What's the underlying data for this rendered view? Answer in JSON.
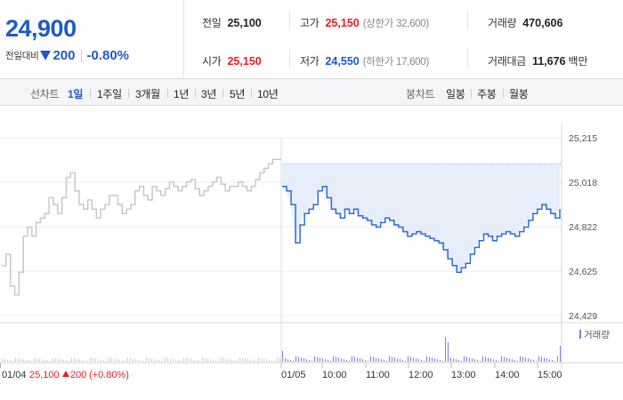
{
  "quote": {
    "current_price": "24,900",
    "change_label": "전일대비",
    "change_value": "200",
    "change_rate": "-0.80%",
    "stats": {
      "prev_close": {
        "label": "전일",
        "value": "25,100"
      },
      "high": {
        "label": "고가",
        "value": "25,150",
        "sub": "(상한가 32,600)"
      },
      "volume": {
        "label": "거래량",
        "value": "470,606"
      },
      "open": {
        "label": "시가",
        "value": "25,150"
      },
      "low": {
        "label": "저가",
        "value": "24,550",
        "sub": "(하한가 17,600)"
      },
      "trade_amount": {
        "label": "거래대금",
        "value": "11,676",
        "unit": "백만"
      }
    }
  },
  "toolbar": {
    "line_chart_label": "선차트",
    "ranges": [
      "1일",
      "1주일",
      "3개월",
      "1년",
      "3년",
      "5년",
      "10년"
    ],
    "active_range": "1일",
    "candle_chart_label": "봉차트",
    "candle_options": [
      "일봉",
      "주봉",
      "월봉"
    ]
  },
  "colors": {
    "price_down": "#1f5ac8",
    "price_up": "#e2202a",
    "today_line": "#2f6fd0",
    "prev_line": "#c8c8c8",
    "fill": "#e6eefa",
    "volume_bar": "#8a7bd0"
  },
  "chart_data": {
    "type": "line",
    "ylim": [
      24429,
      25215
    ],
    "y_ticks": [
      "25,215",
      "25,018",
      "24,822",
      "24,625",
      "24,429"
    ],
    "y_tick_values": [
      25215,
      25018,
      24822,
      24625,
      24429
    ],
    "x_ticks": [
      "01/04",
      "01/05",
      "10:00",
      "11:00",
      "12:00",
      "13:00",
      "14:00",
      "15:00"
    ],
    "prev_close": 25100,
    "legend": "거래량",
    "footer": {
      "date": "01/04",
      "price": "25,100",
      "change": "200",
      "rate": "(+0.80%)"
    },
    "series": [
      {
        "values": [
          24650,
          24700,
          24560,
          24520,
          24620,
          24780,
          24820,
          24780,
          24840,
          24860,
          24880,
          24950,
          24920,
          24880,
          24950,
          25040,
          25060,
          24980,
          24920,
          24900,
          24940,
          24900,
          24860,
          24900,
          24920,
          24960,
          24960,
          24920,
          24880,
          24900,
          24920,
          24980,
          25000,
          24960,
          24940,
          25000,
          24980,
          24960,
          24990,
          25020,
          25000,
          24980,
          25000,
          25020,
          25030,
          24990,
          24960,
          24980,
          25000,
          25020,
          25040,
          25010,
          24980,
          25000,
          25000,
          25020,
          25000,
          24980,
          25000,
          25030,
          25060,
          25080,
          25100,
          25120,
          25120,
          25120
        ]
      },
      {
        "values": [
          25000,
          24980,
          24920,
          24750,
          24830,
          24880,
          24900,
          24920,
          24980,
          25000,
          24950,
          24900,
          24880,
          24860,
          24900,
          24880,
          24900,
          24870,
          24860,
          24850,
          24830,
          24820,
          24840,
          24860,
          24850,
          24830,
          24820,
          24800,
          24780,
          24790,
          24800,
          24790,
          24780,
          24770,
          24760,
          24750,
          24720,
          24680,
          24650,
          24620,
          24640,
          24660,
          24700,
          24730,
          24760,
          24790,
          24780,
          24760,
          24780,
          24790,
          24800,
          24790,
          24780,
          24800,
          24820,
          24850,
          24880,
          24900,
          24920,
          24900,
          24880,
          24860,
          24900
        ]
      }
    ]
  }
}
